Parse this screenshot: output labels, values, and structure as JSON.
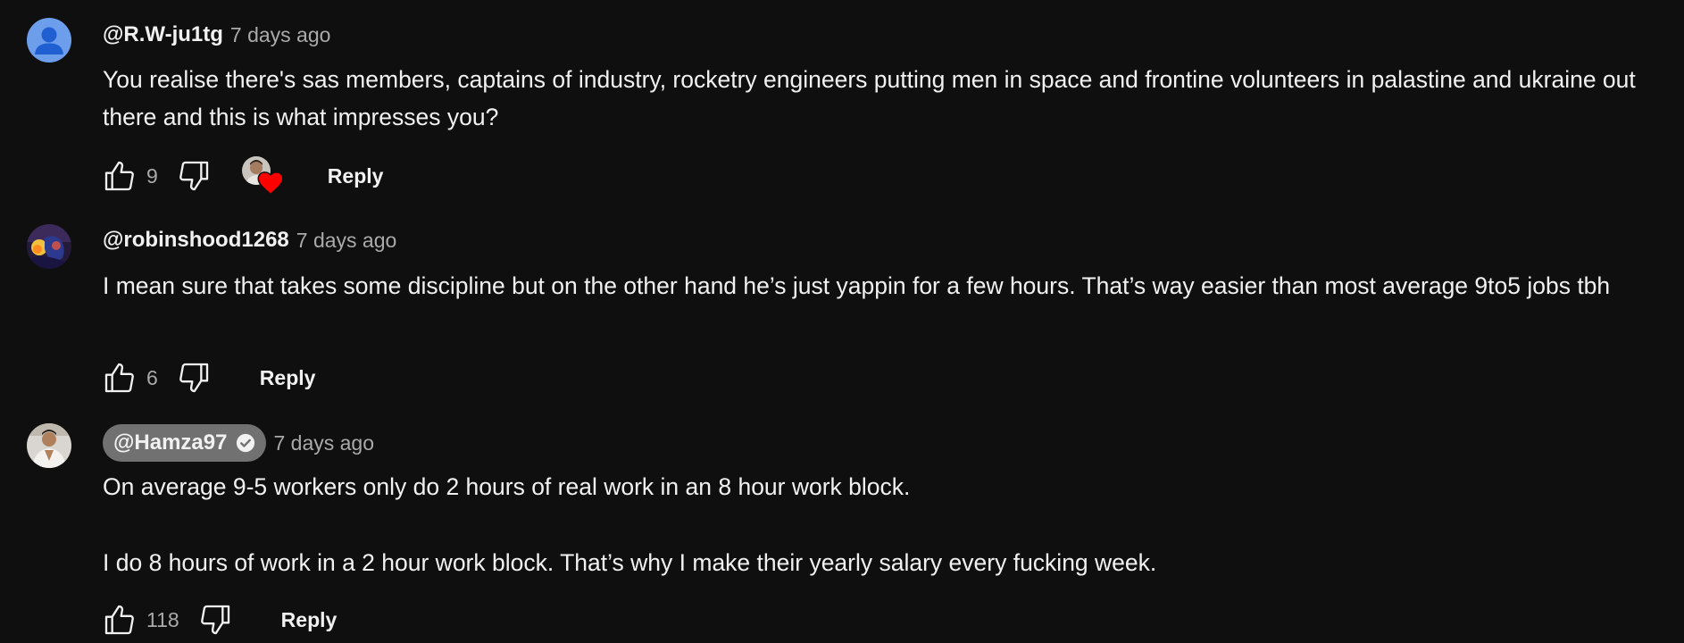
{
  "comments": [
    {
      "author": "@R.W-ju1tg",
      "time": "7 days ago",
      "text": "You realise there's sas members, captains of industry, rocketry engineers putting men in space and frontine volunteers in palastine and ukraine out there and this is what impresses you?",
      "likes": "9",
      "reply_label": "Reply",
      "hearted_by_creator": true,
      "avatar": "default-person-avatar"
    },
    {
      "author": "@robinshood1268",
      "time": "7 days ago",
      "text": "I mean sure that takes some discipline but on the other hand he’s just yappin for a few hours. That’s way easier than most average 9to5 jobs tbh",
      "likes": "6",
      "reply_label": "Reply",
      "avatar": "photo-avatar"
    },
    {
      "author": "@Hamza97",
      "time": "7 days ago",
      "text_line1": "On average 9-5 workers only do 2 hours of real work in an 8 hour work block.",
      "text_line2": "I do 8 hours of work in a 2 hour work block. That’s why I make their yearly salary every fucking week.",
      "likes": "118",
      "reply_label": "Reply",
      "verified": true,
      "is_channel_owner": true,
      "avatar": "photo-avatar"
    }
  ],
  "colors": {
    "background": "#0f0f0f",
    "text": "#f1f1f1",
    "secondary_text": "#aaaaaa",
    "owner_pill": "#717171",
    "heart": "#ff0000",
    "default_avatar": "#6d9eeb"
  }
}
